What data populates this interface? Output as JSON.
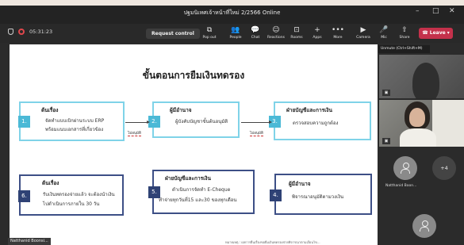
{
  "window": {
    "title": "ปฐมนิเทศเจ้าหน้าที่ใหม่ 2/2566 Online",
    "minimize": "–",
    "restore": "□",
    "close": "✕"
  },
  "toolbar": {
    "timer": "05:31:23",
    "request_control": "Request control",
    "items": [
      {
        "label": "Pop out",
        "icon": "pop-out-icon",
        "glyph": "⧉"
      },
      {
        "label": "People",
        "icon": "people-icon",
        "glyph": "👥"
      },
      {
        "label": "Chat",
        "icon": "chat-icon",
        "glyph": "💬"
      },
      {
        "label": "Reactions",
        "icon": "reactions-icon",
        "glyph": "☺"
      },
      {
        "label": "Rooms",
        "icon": "rooms-icon",
        "glyph": "⊡"
      },
      {
        "label": "Apps",
        "icon": "apps-icon",
        "glyph": "+"
      },
      {
        "label": "More",
        "icon": "more-icon",
        "glyph": "•••"
      },
      {
        "label": "Camera",
        "icon": "camera-icon",
        "glyph": "▶"
      },
      {
        "label": "Mic",
        "icon": "mic-icon",
        "glyph": "🎤"
      },
      {
        "label": "Share",
        "icon": "share-icon",
        "glyph": "⇧"
      }
    ],
    "leave": "Leave",
    "leave_color": "#c4314b"
  },
  "tooltip": "Unmute (Ctrl+Shift+M)",
  "slide": {
    "title": "ขั้นตอนการยืมเงินทดรอง",
    "steps": [
      {
        "num": "1.",
        "heading": "ต้นเรื่อง",
        "line1": "จัดทำแบบเบิกผ่านระบบ ERP",
        "line2": "พร้อมแนบเอกสารที่เกี่ยวข้อง"
      },
      {
        "num": "2.",
        "heading": "ผู้มีอำนาจ",
        "line1": "ผู้บังคับบัญชาขั้นต้นอนุมัติ",
        "line2": ""
      },
      {
        "num": "3.",
        "heading": "ฝ่ายบัญชีและการเงิน",
        "line1": "ตรวจสอบความถูกต้อง",
        "line2": ""
      },
      {
        "num": "4.",
        "heading": "ผู้มีอำนาจ",
        "line1": "พิจารณาอนุมัติตามวงเงิน",
        "line2": ""
      },
      {
        "num": "5.",
        "heading": "ฝ่ายบัญชีและการเงิน",
        "line1": "ดำเนินการจัดทำ E-Cheque",
        "line2": "ทำจ่ายทุกวันที่15 และ30 ของทุกเดือน"
      },
      {
        "num": "6.",
        "heading": "ต้นเรื่อง",
        "line1": "รับเงินทดรองจ่ายแล้ว จะต้องนำเงิน",
        "line2": "ไปดำเนินการภายใน 30 วัน"
      }
    ],
    "reject_label": "ไม่อนุมัติ",
    "footer": "หมายเหตุ : ผลการยื่นเรื่องขอยืมเงินทดรองจ่ายพิจารณาตามเงื่อนไข..."
  },
  "presenter": "Natthanid Boonsi...",
  "participants": {
    "avatar_name": "Natthanid Boon...",
    "more_count": "+4"
  }
}
